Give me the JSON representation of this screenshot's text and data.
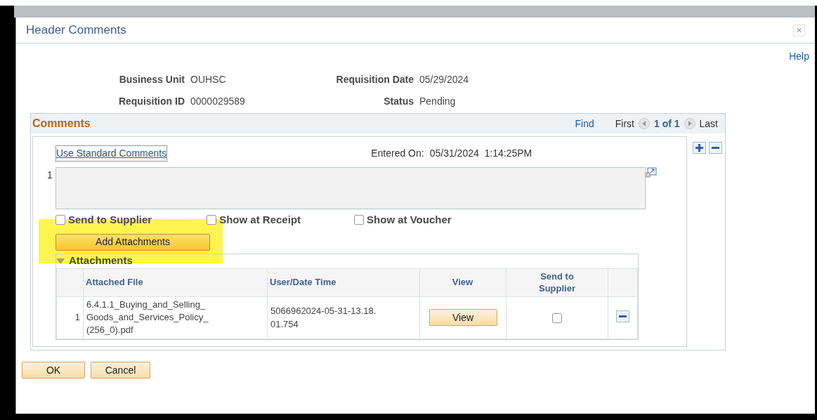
{
  "window": {
    "title": "Header Comments",
    "close": "×"
  },
  "help_link": "Help",
  "fields": [
    {
      "label": "Business Unit",
      "value": "OUHSC"
    },
    {
      "label": "Requisition Date",
      "value": "05/29/2024"
    },
    {
      "label": "Requisition ID",
      "value": "0000029589"
    },
    {
      "label": "Status",
      "value": "Pending"
    }
  ],
  "comments": {
    "title": "Comments",
    "find": "Find",
    "first": "First",
    "position": "1 of 1",
    "last": "Last",
    "use_standard_comments": "Use Standard Comments",
    "entered_on_label": "Entered On:",
    "entered_on": "05/31/2024  1:14:25PM",
    "row_number": "1",
    "checkboxes": [
      {
        "label": "Send to Supplier",
        "checked": false
      },
      {
        "label": "Show at Receipt",
        "checked": false
      },
      {
        "label": "Show at Voucher",
        "checked": false
      }
    ],
    "add_attachments": {
      "label": "Add Attachments",
      "highlighted": true
    },
    "attachments": {
      "title": "Attachments",
      "expanded": true,
      "columns": [
        "Attached File",
        "User/Date Time",
        "View",
        "Send to Supplier"
      ],
      "rows": [
        {
          "number": "1",
          "file": "6.4.1.1_Buying_and_Selling_Goods_and_Services_Policy_(256_0).pdf",
          "user_date_time": "5066962024-05-31-13.18.01.754",
          "view": "View",
          "send_to_supplier": false
        }
      ]
    }
  },
  "buttons": [
    "OK",
    "Cancel"
  ]
}
